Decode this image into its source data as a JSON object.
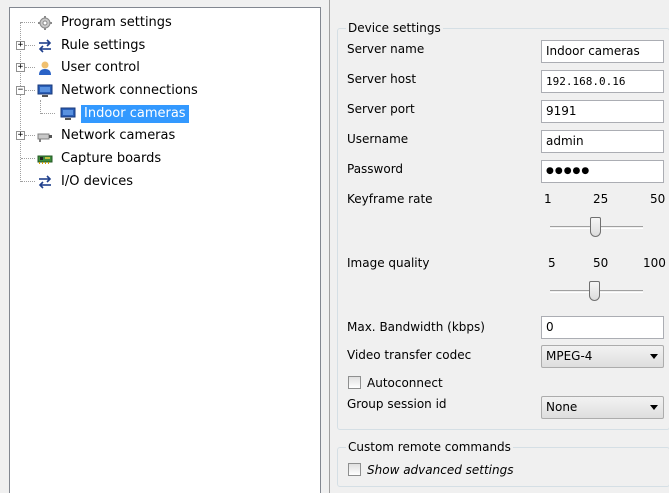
{
  "tree": {
    "items": [
      {
        "label": "Program settings",
        "icon": "gear-icon"
      },
      {
        "label": "Rule settings",
        "icon": "arrows-icon"
      },
      {
        "label": "User control",
        "icon": "user-icon"
      },
      {
        "label": "Network connections",
        "icon": "monitor-icon"
      },
      {
        "label": "Indoor cameras",
        "icon": "monitor-icon"
      },
      {
        "label": "Network cameras",
        "icon": "camera-icon"
      },
      {
        "label": "Capture boards",
        "icon": "board-icon"
      },
      {
        "label": "I/O devices",
        "icon": "arrows-icon"
      }
    ],
    "expand_plus": "+",
    "expand_minus": "−"
  },
  "device_settings": {
    "title": "Device settings",
    "server_name_label": "Server name",
    "server_name": "Indoor cameras",
    "server_host_label": "Server host",
    "server_host": "192.168.0.16",
    "server_port_label": "Server port",
    "server_port": "9191",
    "username_label": "Username",
    "username": "admin",
    "password_label": "Password",
    "password": "●●●●●",
    "keyframe_label": "Keyframe rate",
    "keyframe_ticks": [
      "1",
      "25",
      "50"
    ],
    "keyframe_value": 25,
    "image_quality_label": "Image quality",
    "image_quality_ticks": [
      "5",
      "50",
      "100"
    ],
    "image_quality_value": 50,
    "bandwidth_label": "Max. Bandwidth (kbps)",
    "bandwidth": "0",
    "codec_label": "Video transfer codec",
    "codec": "MPEG-4",
    "autoconnect_label": "Autoconnect",
    "group_session_label": "Group session id",
    "group_session": "None"
  },
  "custom_remote": {
    "title": "Custom remote commands",
    "show_advanced_label": "Show advanced settings"
  },
  "colors": {
    "selection": "#3399ff",
    "pane_border": "#828790"
  }
}
